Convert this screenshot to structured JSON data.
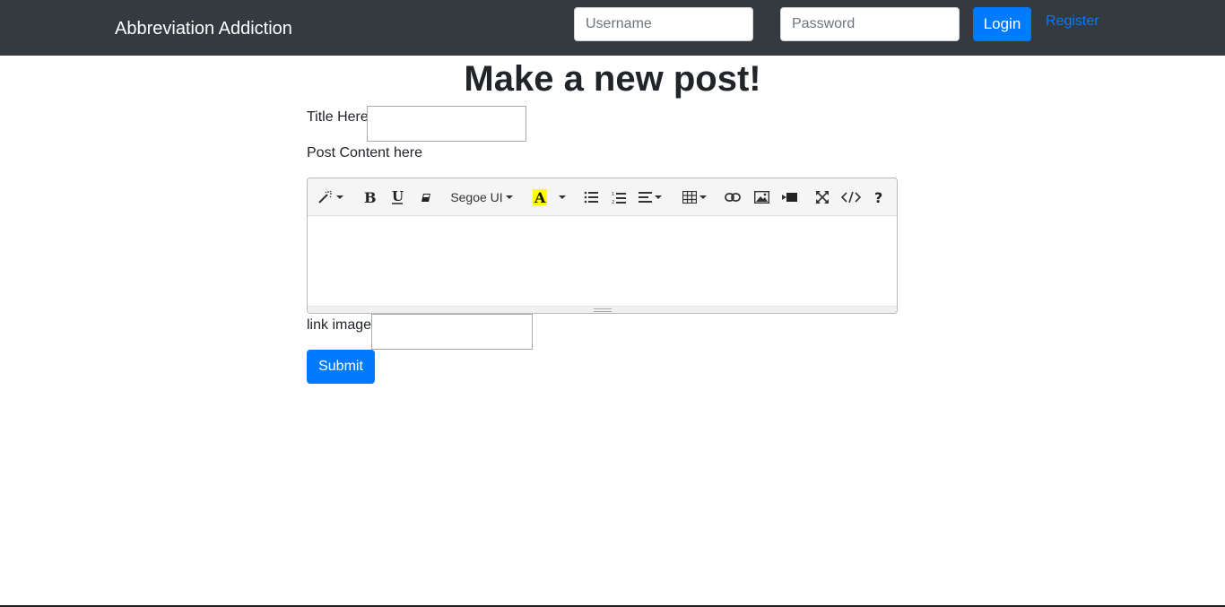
{
  "navbar": {
    "brand": "Abbreviation Addiction",
    "username_placeholder": "Username",
    "password_placeholder": "Password",
    "login_label": "Login",
    "register_label": "Register"
  },
  "main": {
    "title": "Make a new post!",
    "title_label": "Title Here",
    "content_label": "Post Content here",
    "link_image_label": "link image",
    "submit_label": "Submit"
  },
  "editor": {
    "font_name": "Segoe UI",
    "toolbar_icons": [
      "magic-wand-icon",
      "bold-icon",
      "underline-icon",
      "eraser-icon",
      "font-name-dropdown",
      "text-color-icon",
      "color-dropdown-icon",
      "unordered-list-icon",
      "ordered-list-icon",
      "align-icon",
      "table-icon",
      "link-icon",
      "picture-icon",
      "video-icon",
      "fullscreen-icon",
      "code-view-icon",
      "help-icon"
    ],
    "highlight_color": "#ffff00"
  },
  "colors": {
    "navbar_bg": "#343a40",
    "primary": "#007bff"
  }
}
